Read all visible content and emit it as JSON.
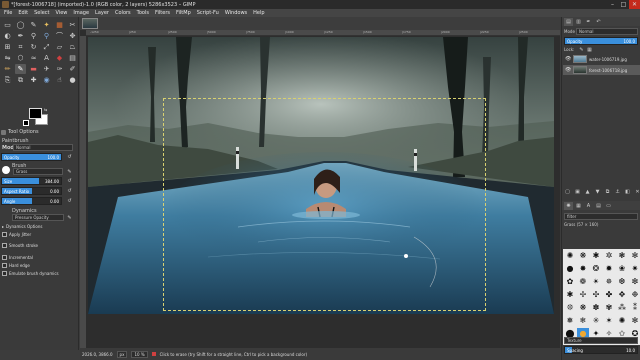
{
  "window": {
    "title": "*[forest-1006718] (imported)-1.0 (RGB color, 2 layers) 5286x3523 – GIMP",
    "minimize": "–",
    "maximize": "□",
    "close": "✕"
  },
  "menu": [
    "File",
    "Edit",
    "Select",
    "View",
    "Image",
    "Layer",
    "Colors",
    "Tools",
    "Filters",
    "FiltMp",
    "Script-Fu",
    "Windows",
    "Help"
  ],
  "toolbox": {
    "tools": [
      {
        "name": "rect-select-icon",
        "glyph": "▭",
        "color": "#cfcfcf"
      },
      {
        "name": "ellipse-select-icon",
        "glyph": "◯",
        "color": "#cfcfcf"
      },
      {
        "name": "free-select-icon",
        "glyph": "✎",
        "color": "#cfcfcf"
      },
      {
        "name": "fuzzy-select-icon",
        "glyph": "✦",
        "color": "#e8c060"
      },
      {
        "name": "select-by-color-icon",
        "glyph": "▦",
        "color": "#e07030"
      },
      {
        "name": "scissors-icon",
        "glyph": "✂",
        "color": "#cfcfcf"
      },
      {
        "name": "foreground-select-icon",
        "glyph": "◐",
        "color": "#cfcfcf"
      },
      {
        "name": "paths-icon",
        "glyph": "✒",
        "color": "#cfcfcf"
      },
      {
        "name": "color-picker-icon",
        "glyph": "⚲",
        "color": "#cfcfcf"
      },
      {
        "name": "zoom-icon",
        "glyph": "⚲",
        "color": "#7fa8d8"
      },
      {
        "name": "measure-icon",
        "glyph": "⌒",
        "color": "#cfcfcf"
      },
      {
        "name": "move-icon",
        "glyph": "✥",
        "color": "#cfcfcf"
      },
      {
        "name": "align-icon",
        "glyph": "⊞",
        "color": "#cfcfcf"
      },
      {
        "name": "crop-icon",
        "glyph": "⌗",
        "color": "#cfcfcf"
      },
      {
        "name": "rotate-icon",
        "glyph": "↻",
        "color": "#cfcfcf"
      },
      {
        "name": "scale-icon",
        "glyph": "⤢",
        "color": "#cfcfcf"
      },
      {
        "name": "shear-icon",
        "glyph": "▱",
        "color": "#cfcfcf"
      },
      {
        "name": "perspective-icon",
        "glyph": "⏢",
        "color": "#cfcfcf"
      },
      {
        "name": "flip-icon",
        "glyph": "⇋",
        "color": "#cfcfcf"
      },
      {
        "name": "cage-icon",
        "glyph": "⬡",
        "color": "#cfcfcf"
      },
      {
        "name": "warp-icon",
        "glyph": "≈",
        "color": "#cfcfcf"
      },
      {
        "name": "text-icon",
        "glyph": "A",
        "color": "#cfcfcf"
      },
      {
        "name": "bucket-fill-icon",
        "glyph": "◆",
        "color": "#d04040"
      },
      {
        "name": "blend-icon",
        "glyph": "▤",
        "color": "#cfcfcf"
      },
      {
        "name": "pencil-icon",
        "glyph": "✏",
        "color": "#e0b060"
      },
      {
        "name": "paintbrush-icon",
        "glyph": "✎",
        "color": "#ffffff"
      },
      {
        "name": "eraser-icon",
        "glyph": "▬",
        "color": "#e06060"
      },
      {
        "name": "airbrush-icon",
        "glyph": "✈",
        "color": "#cfcfcf"
      },
      {
        "name": "ink-icon",
        "glyph": "✑",
        "color": "#cfcfcf"
      },
      {
        "name": "mypaint-brush-icon",
        "glyph": "✐",
        "color": "#cfcfcf"
      },
      {
        "name": "clone-icon",
        "glyph": "⎘",
        "color": "#cfcfcf"
      },
      {
        "name": "perspective-clone-icon",
        "glyph": "⧉",
        "color": "#cfcfcf"
      },
      {
        "name": "heal-icon",
        "glyph": "✚",
        "color": "#cfcfcf"
      },
      {
        "name": "blur-sharpen-icon",
        "glyph": "◉",
        "color": "#7fa8d8"
      },
      {
        "name": "smudge-icon",
        "glyph": "☝",
        "color": "#cfcfcf"
      },
      {
        "name": "dodge-burn-icon",
        "glyph": "●",
        "color": "#cfcfcf"
      }
    ],
    "active_tool_index": 25
  },
  "tool_options": {
    "tab_label": "Tool Options",
    "tool_name": "Paintbrush",
    "mode_label": "Mode",
    "mode_value": "Normal",
    "opacity": {
      "label": "Opacity",
      "value": "100.0",
      "fraction": 1.0
    },
    "brush_label": "Brush",
    "brush_name": "Grass",
    "size": {
      "label": "Size",
      "value": "384.00",
      "fraction": 0.62
    },
    "aspect_ratio": {
      "label": "Aspect Ratio",
      "value": "0.00",
      "fraction": 0.5
    },
    "angle": {
      "label": "Angle",
      "value": "0.00",
      "fraction": 0.5
    },
    "dynamics_label": "Dynamics",
    "dynamics_value": "Pressure Opacity",
    "dynamics_options": "Dynamics Options",
    "apply_jitter": "Apply Jitter",
    "smooth_stroke": "Smooth stroke",
    "incremental": "Incremental",
    "hard_edge": "Hard edge",
    "emulate": "Emulate brush dynamics",
    "reset": "↺"
  },
  "rulers": {
    "top": [
      "-1250",
      "|250",
      "|2500",
      "|5000",
      "|7500",
      "|1000",
      "|1250",
      "|1500",
      "|1750",
      "|2000",
      "|2250",
      "|2500"
    ]
  },
  "status": {
    "coords": "2026.0, 3866.0",
    "unit": "px",
    "zoom": "10 %",
    "message": "Click to erase (try Shift for a straight line, Ctrl to pick a background color)"
  },
  "layers_dock": {
    "mode_label": "Mode",
    "mode_value": "Normal",
    "opacity_label": "Opacity",
    "opacity_value": "100.0",
    "lock_label": "Lock:",
    "layers": [
      {
        "name": "water-1006719.jpg",
        "selected": false
      },
      {
        "name": "forest-1006718.jpg",
        "selected": true
      }
    ]
  },
  "brushes_dock": {
    "filter_label": "filter",
    "brush_info": "Grass (57 × 160)",
    "brushes": [
      "✺",
      "❋",
      "✱",
      "✲",
      "❃",
      "✻",
      "●",
      "✸",
      "❂",
      "✹",
      "❀",
      "✷",
      "✿",
      "❁",
      "✴",
      "✵",
      "❆",
      "❇",
      "✱",
      "✢",
      "✣",
      "✤",
      "✥",
      "❉",
      "❊",
      "❋",
      "✽",
      "✾",
      "⁂",
      "⁑",
      "❅",
      "❄",
      "✳",
      "✶",
      "✺",
      "✻",
      "⬤",
      "●",
      "✦",
      "✧",
      "✩",
      "✪"
    ],
    "selected_index": 37,
    "tag_label": "Texture",
    "spacing_label": "Spacing",
    "spacing_value": "10.0"
  },
  "colors": {
    "canvas_bg": "#2d2d2d",
    "accent": "#3a8fdc",
    "selection": "#d8d070"
  }
}
